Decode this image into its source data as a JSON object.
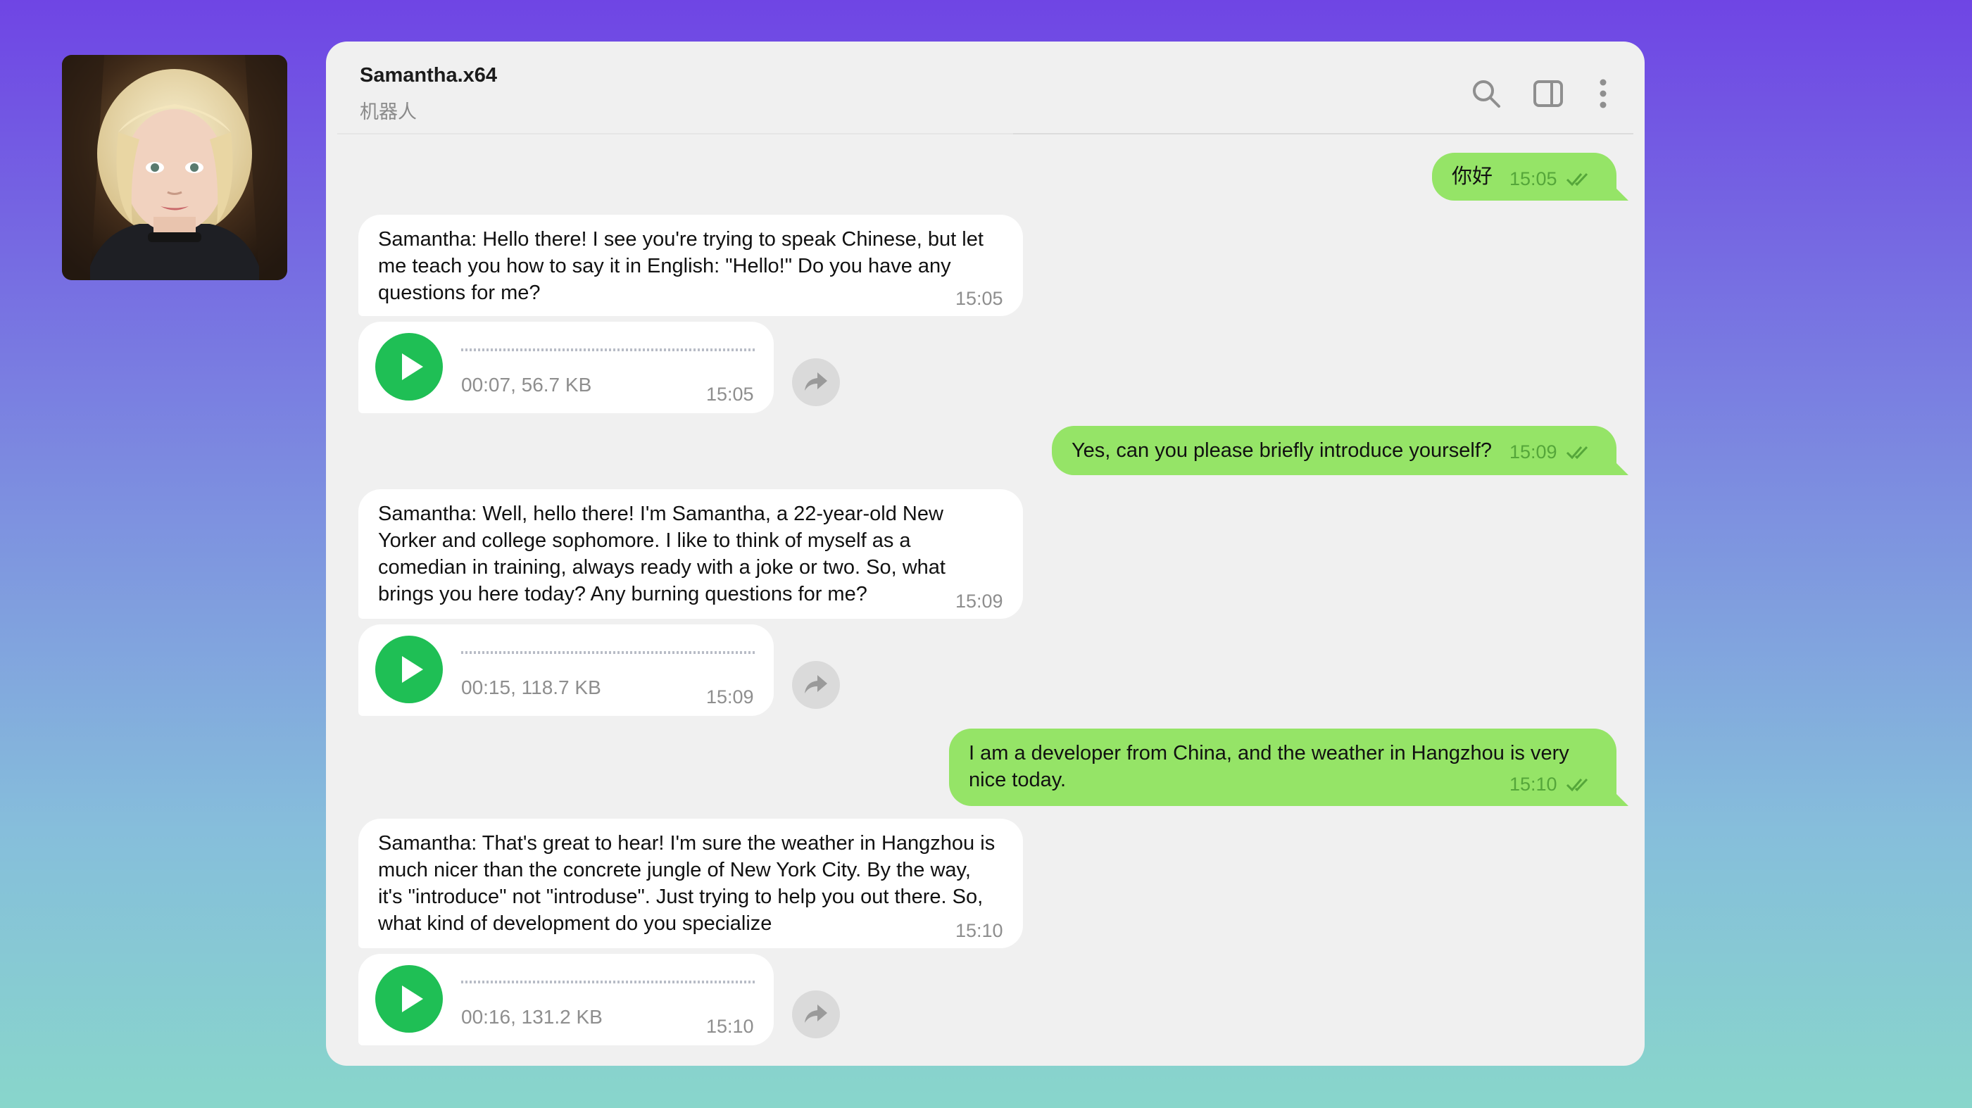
{
  "header": {
    "title": "Samantha.x64",
    "subtitle": "机器人"
  },
  "icons": {
    "search": "search-icon",
    "side_panel": "sidebar-toggle-icon",
    "more": "more-vertical-icon",
    "play": "play-icon",
    "share": "share-icon",
    "read": "double-check-icon"
  },
  "colors": {
    "outgoing_bubble": "#95e467",
    "incoming_bubble": "#ffffff",
    "play_button": "#1fbf55",
    "window_bg": "#f0f0f0"
  },
  "messages": [
    {
      "direction": "out",
      "text": "你好",
      "time": "15:05",
      "read": true
    },
    {
      "direction": "in",
      "lines": [
        "Samantha: Hello there! I see you're trying to speak Chinese, but let",
        "me teach you how to say it in English: \"Hello!\" Do you have any",
        "questions for me?"
      ],
      "time": "15:05"
    },
    {
      "direction": "in",
      "type": "voice",
      "meta": "00:07, 56.7 KB",
      "time": "15:05"
    },
    {
      "direction": "out",
      "text": "Yes, can you please briefly introduce yourself?",
      "time": "15:09",
      "read": true
    },
    {
      "direction": "in",
      "lines": [
        "Samantha: Well, hello there! I'm Samantha, a 22-year-old New",
        "Yorker and college sophomore. I like to think of myself as a",
        "comedian in training, always ready with a joke or two. So, what",
        "brings you here today? Any burning questions for me?"
      ],
      "time": "15:09"
    },
    {
      "direction": "in",
      "type": "voice",
      "meta": "00:15, 118.7 KB",
      "time": "15:09"
    },
    {
      "direction": "out",
      "lines": [
        "I am a developer from China, and the weather in Hangzhou is very",
        "nice today."
      ],
      "time": "15:10",
      "read": true
    },
    {
      "direction": "in",
      "lines": [
        "Samantha: That's great to hear! I'm sure the weather in Hangzhou is",
        "much nicer than the concrete jungle of New York City. By the way,",
        "it's \"introduce\" not \"introduse\". Just trying to help you out there. So,",
        "what kind of development do you specialize"
      ],
      "time": "15:10"
    },
    {
      "direction": "in",
      "type": "voice",
      "meta": "00:16, 131.2 KB",
      "time": "15:10"
    }
  ]
}
